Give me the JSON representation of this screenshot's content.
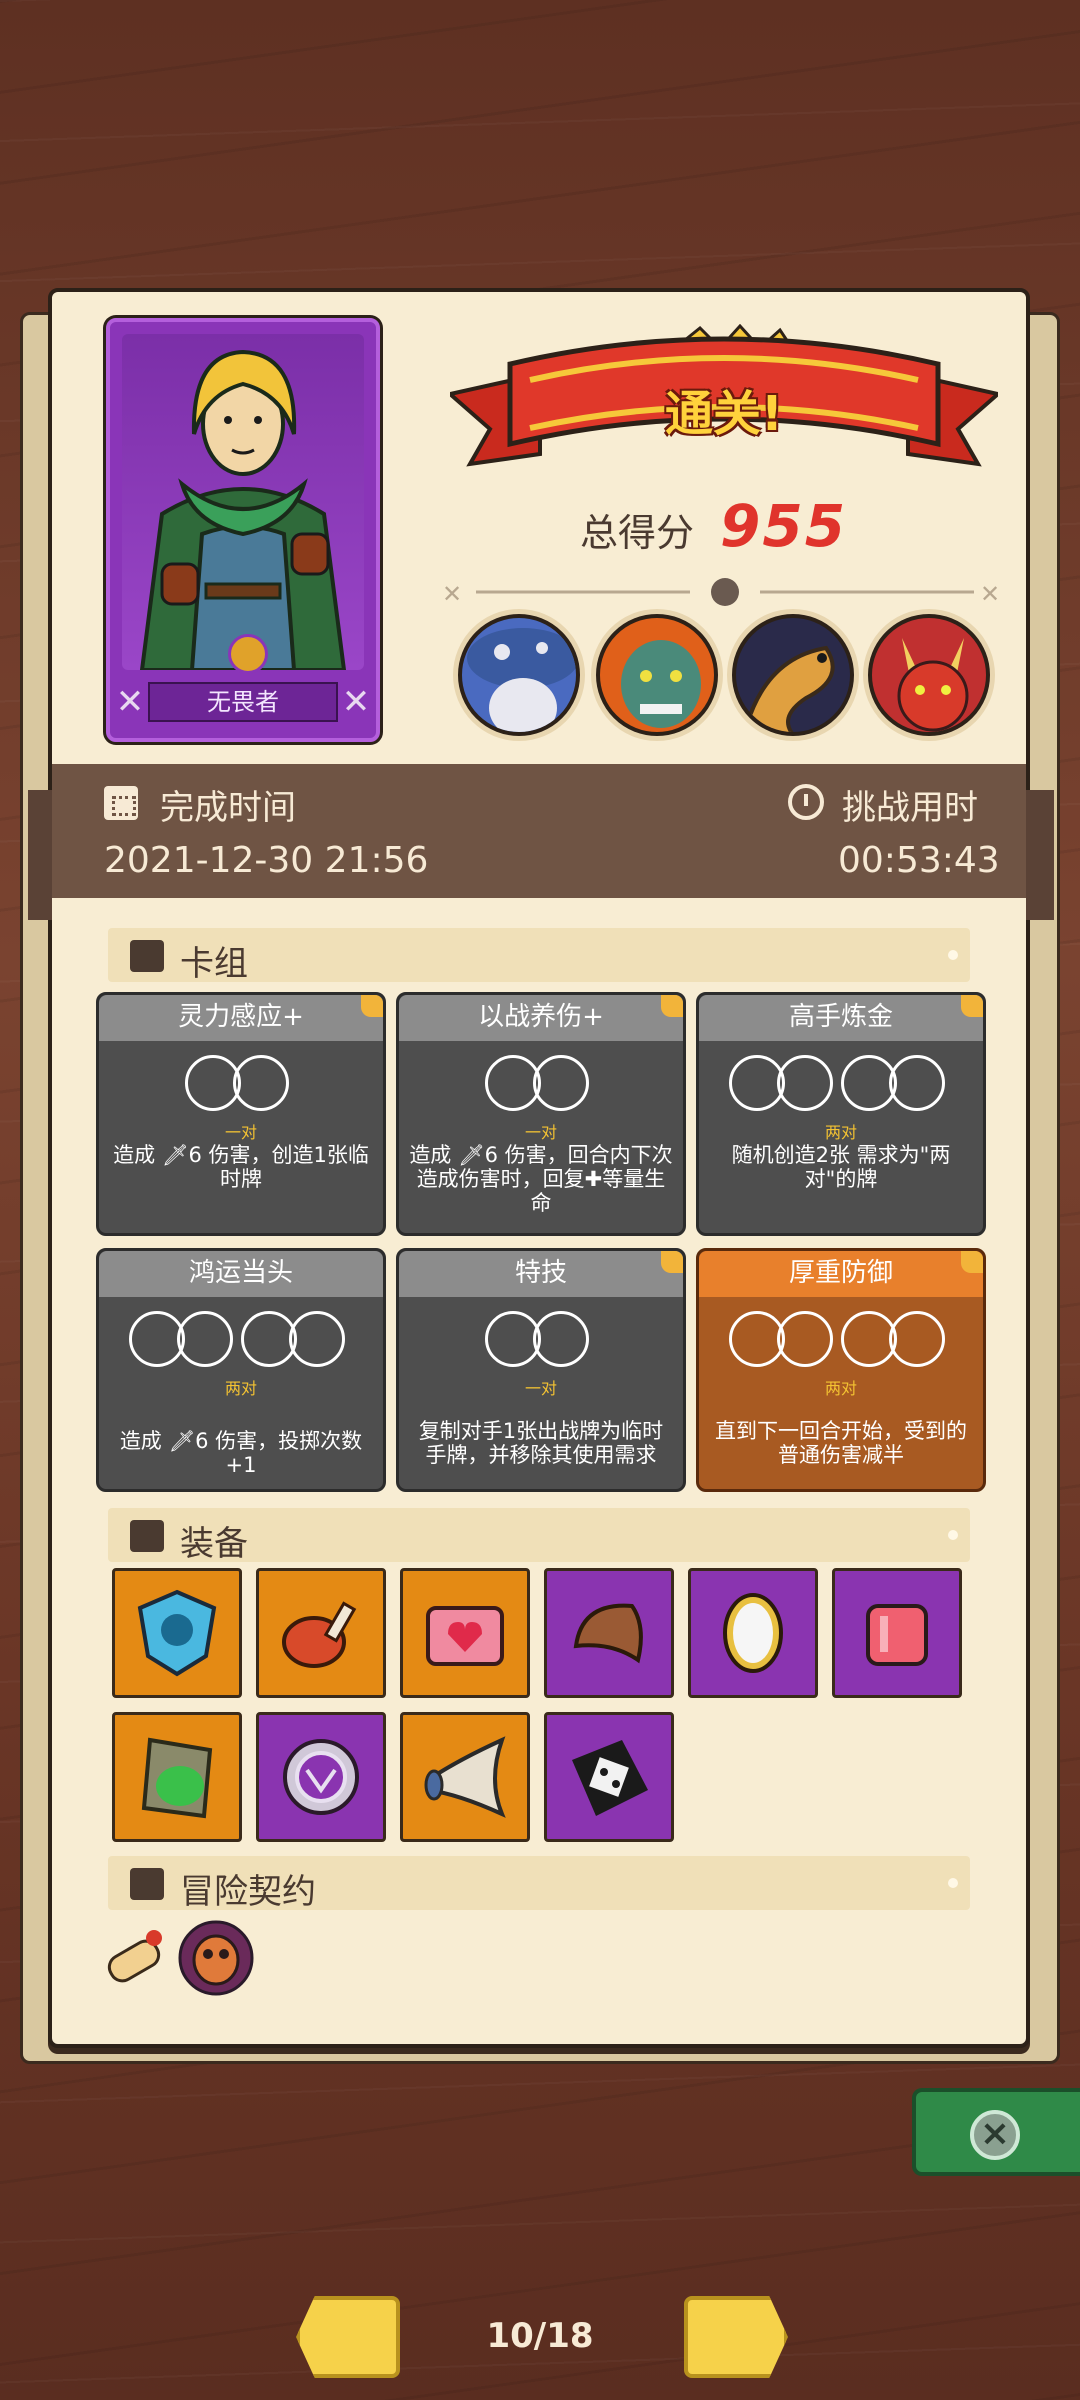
{
  "result": {
    "banner": "通关!",
    "score_label": "总得分",
    "score_value": "955"
  },
  "hero": {
    "name": "无畏者"
  },
  "time": {
    "finish_label": "完成时间",
    "finish_value": "2021-12-30 21:56",
    "challenge_label": "挑战用时",
    "challenge_value": "00:53:43"
  },
  "deck": {
    "title": "卡组",
    "cards": [
      {
        "name": "灵力感应+",
        "pair": "一对",
        "desc": "造成 🗡6 伤害，创造1张临时牌"
      },
      {
        "name": "以战养伤+",
        "pair": "一对",
        "desc": "造成 🗡6 伤害，回合内下次造成伤害时，回复✚等量生命"
      },
      {
        "name": "高手炼金",
        "pair": "两对",
        "desc": "随机创造2张 需求为\"两对\"的牌"
      },
      {
        "name": "鸿运当头",
        "pair": "两对",
        "desc": "造成 🗡6 伤害，投掷次数+1"
      },
      {
        "name": "特技",
        "pair": "一对",
        "desc": "复制对手1张出战牌为临时手牌，并移除其使用需求"
      },
      {
        "name": "厚重防御",
        "pair": "两对",
        "desc": "直到下一回合开始，受到的普通伤害减半"
      }
    ]
  },
  "equipment": {
    "title": "装备",
    "items": [
      {
        "icon": "shield-skull-icon",
        "color": "orange"
      },
      {
        "icon": "meat-leg-icon",
        "color": "orange"
      },
      {
        "icon": "heart-box-icon",
        "color": "orange"
      },
      {
        "icon": "leather-pauldron-icon",
        "color": "purple"
      },
      {
        "icon": "mirror-icon",
        "color": "purple"
      },
      {
        "icon": "flesh-chunk-icon",
        "color": "purple"
      },
      {
        "icon": "mossy-stone-icon",
        "color": "orange"
      },
      {
        "icon": "rune-shield-icon",
        "color": "purple"
      },
      {
        "icon": "horn-icon",
        "color": "orange"
      },
      {
        "icon": "cursed-dice-icon",
        "color": "purple"
      }
    ]
  },
  "contracts": {
    "title": "冒险契约"
  },
  "pagination": {
    "indicator": "10/18"
  }
}
